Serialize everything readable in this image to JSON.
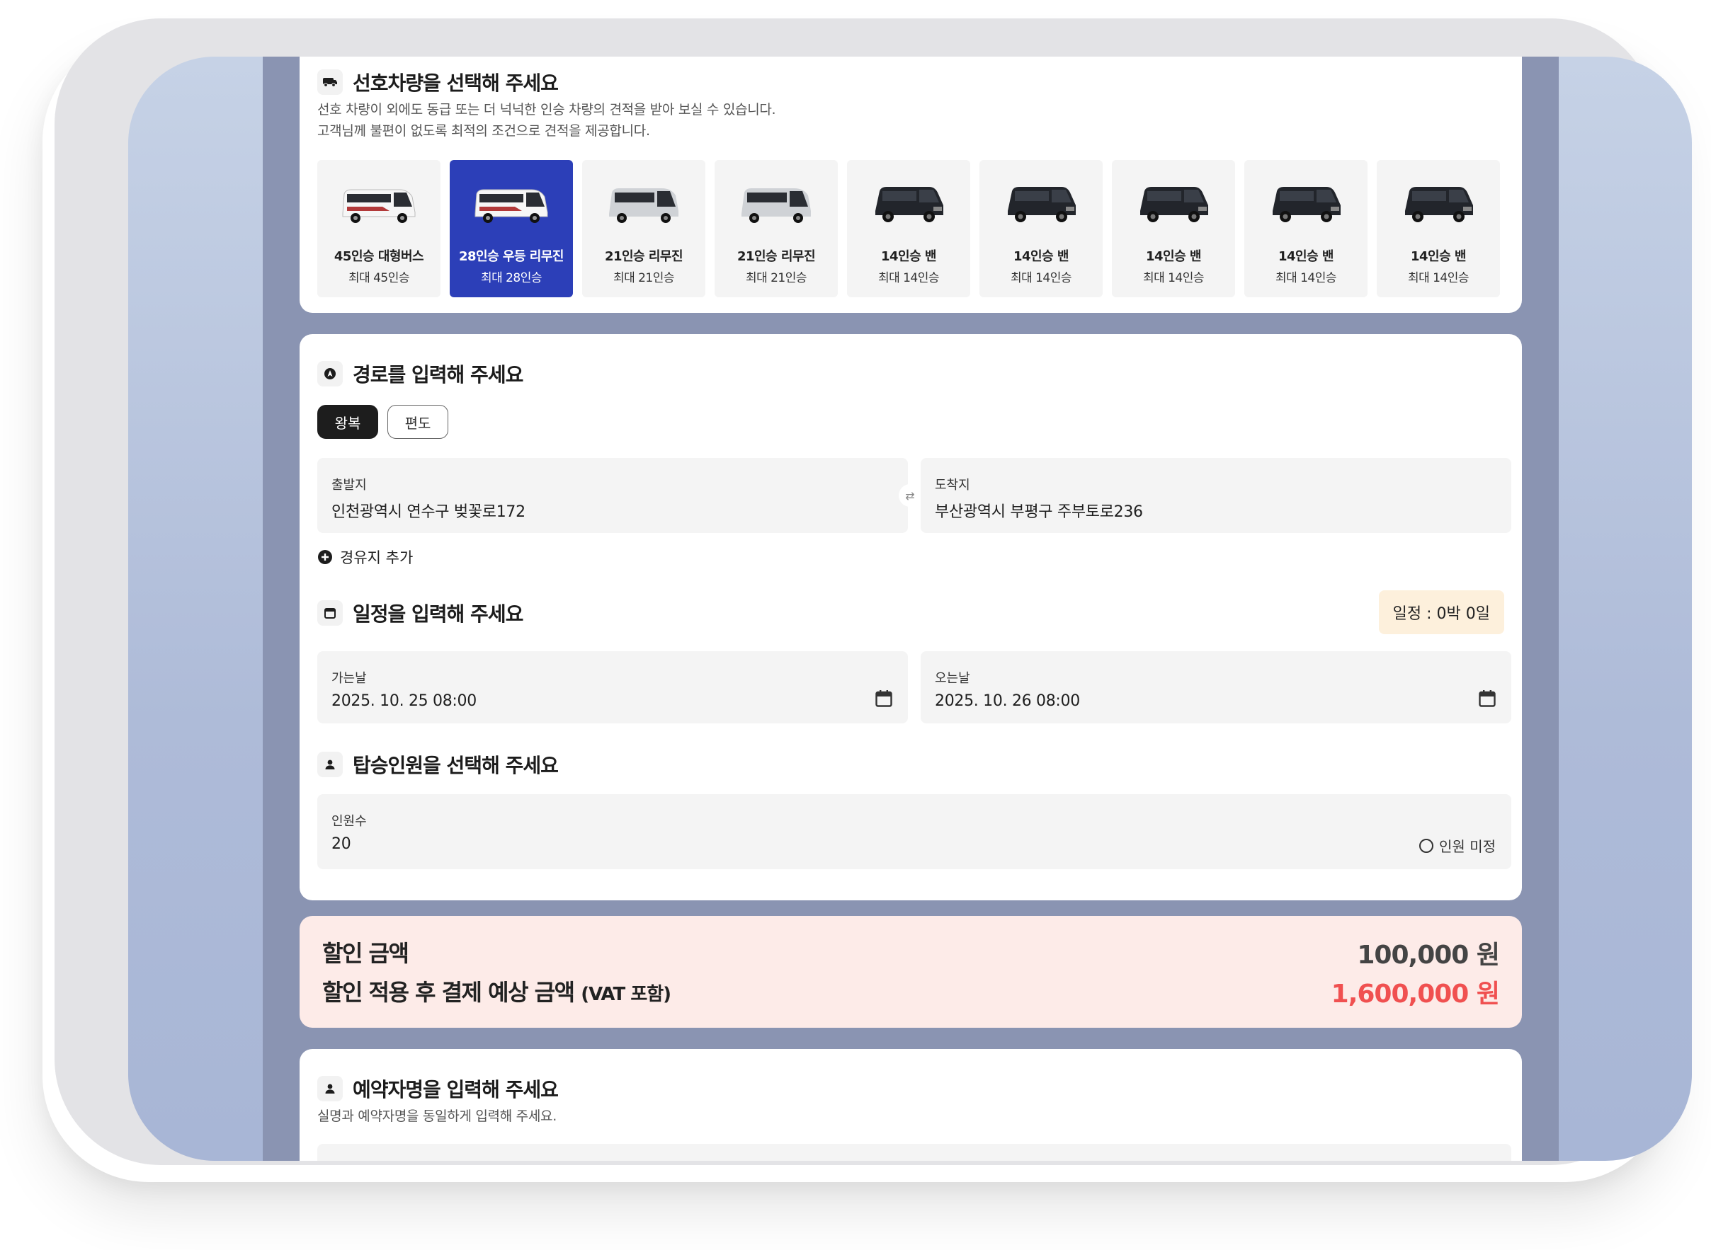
{
  "vehicle_section": {
    "title": "선호차량을 선택해 주세요",
    "desc_line1": "선호 차량이 외에도 동급 또는 더 넉넉한 인승 차량의 견적을 받아 보실 수 있습니다.",
    "desc_line2": "고객님께 불편이 없도록 최적의 조건으로 견적을 제공합니다.",
    "vehicles": [
      {
        "name": "45인승 대형버스",
        "capacity": "최대 45인승",
        "kind": "white-bus",
        "selected": false
      },
      {
        "name": "28인승 우등 리무진",
        "capacity": "최대 28인승",
        "kind": "white-bus",
        "selected": true
      },
      {
        "name": "21인승 리무진",
        "capacity": "최대 21인승",
        "kind": "silver-bus",
        "selected": false
      },
      {
        "name": "21인승 리무진",
        "capacity": "최대 21인승",
        "kind": "silver-bus",
        "selected": false
      },
      {
        "name": "14인승 밴",
        "capacity": "최대 14인승",
        "kind": "black-van",
        "selected": false
      },
      {
        "name": "14인승 밴",
        "capacity": "최대 14인승",
        "kind": "black-van",
        "selected": false
      },
      {
        "name": "14인승 밴",
        "capacity": "최대 14인승",
        "kind": "black-van",
        "selected": false
      },
      {
        "name": "14인승 밴",
        "capacity": "최대 14인승",
        "kind": "black-van",
        "selected": false
      },
      {
        "name": "14인승 밴",
        "capacity": "최대 14인승",
        "kind": "black-van",
        "selected": false
      }
    ]
  },
  "route_section": {
    "title": "경로를 입력해 주세요",
    "trip_round": "왕복",
    "trip_oneway": "편도",
    "origin_label": "출발지",
    "origin_value": "인천광역시 연수구 벚꽃로172",
    "dest_label": "도착지",
    "dest_value": "부산광역시 부평구 주부토로236",
    "add_stop": "경유지 추가"
  },
  "schedule_section": {
    "title": "일정을 입력해 주세요",
    "badge": "일정 : 0박 0일",
    "depart_label": "가는날",
    "depart_value": "2025. 10. 25 08:00",
    "return_label": "오는날",
    "return_value": "2025. 10. 26 08:00"
  },
  "passenger_section": {
    "title": "탑승인원을 선택해 주세요",
    "count_label": "인원수",
    "count_value": "20",
    "undecided": "인원 미정"
  },
  "price_section": {
    "discount_label": "할인 금액",
    "discount_value": "100,000 원",
    "total_label": "할인 적용 후 결제 예상 금액",
    "total_suffix": "(VAT 포함)",
    "total_value": "1,600,000 원",
    "total_color": "#f05050",
    "discount_color": "#444444"
  },
  "reserver_section": {
    "title": "예약자명을 입력해 주세요",
    "desc": "실명과 예약자명을 동일하게 입력해 주세요."
  }
}
